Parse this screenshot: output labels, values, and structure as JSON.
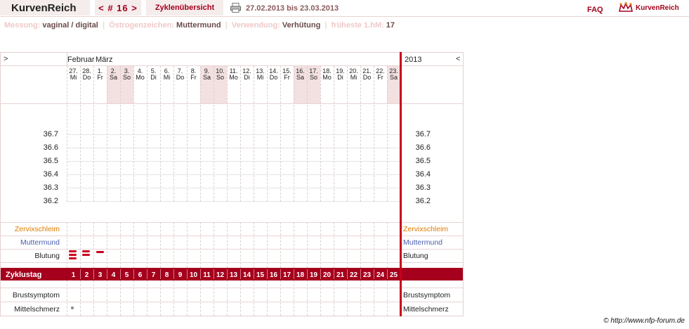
{
  "header": {
    "logo": "KurvenReich",
    "cycle_nav": "< # 16 >",
    "overview": "Zyklenübersicht",
    "date_range": "27.02.2013 bis 23.03.2013",
    "faq": "FAQ",
    "brand": "KurvenReich"
  },
  "info": {
    "messung_label": "Messung:",
    "messung_value": "vaginal / digital",
    "oestrogen_label": "Östrogenzeichen:",
    "oestrogen_value": "Muttermund",
    "verwendung_label": "Verwendung:",
    "verwendung_value": "Verhütung",
    "hm_label": "früheste 1.hM:",
    "hm_value": "17"
  },
  "chart": {
    "nav_prev": ">",
    "nav_next": "<",
    "month_left": "Februar",
    "month_right": "März",
    "year": "2013",
    "temps": [
      "36.7",
      "36.6",
      "36.5",
      "36.4",
      "36.3",
      "36.2"
    ],
    "days": [
      {
        "n": "27.",
        "w": "Mi"
      },
      {
        "n": "28.",
        "w": "Do"
      },
      {
        "n": "1.",
        "w": "Fr"
      },
      {
        "n": "2.",
        "w": "Sa"
      },
      {
        "n": "3.",
        "w": "So"
      },
      {
        "n": "4.",
        "w": "Mo"
      },
      {
        "n": "5.",
        "w": "Di"
      },
      {
        "n": "6.",
        "w": "Mi"
      },
      {
        "n": "7.",
        "w": "Do"
      },
      {
        "n": "8.",
        "w": "Fr"
      },
      {
        "n": "9.",
        "w": "Sa"
      },
      {
        "n": "10.",
        "w": "So"
      },
      {
        "n": "11.",
        "w": "Mo"
      },
      {
        "n": "12.",
        "w": "Di"
      },
      {
        "n": "13.",
        "w": "Mi"
      },
      {
        "n": "14.",
        "w": "Do"
      },
      {
        "n": "15.",
        "w": "Fr"
      },
      {
        "n": "16.",
        "w": "Sa"
      },
      {
        "n": "17.",
        "w": "So"
      },
      {
        "n": "18.",
        "w": "Mo"
      },
      {
        "n": "19.",
        "w": "Di"
      },
      {
        "n": "20.",
        "w": "Mi"
      },
      {
        "n": "21.",
        "w": "Do"
      },
      {
        "n": "22.",
        "w": "Fr"
      },
      {
        "n": "23.",
        "w": "Sa"
      }
    ],
    "weekend_color": "#f3e0e0",
    "zervix_label": "Zervixschleim",
    "zervix_color": "#e07b00",
    "muttermund_label": "Muttermund",
    "muttermund_color": "#4a5fb0",
    "blutung_label": "Blutung",
    "blutung_marks": [
      3,
      2,
      1
    ],
    "zyklustag_label": "Zyklustag",
    "zyklustag_days": [
      "1",
      "2",
      "3",
      "4",
      "5",
      "6",
      "7",
      "8",
      "9",
      "10",
      "11",
      "12",
      "13",
      "14",
      "15",
      "16",
      "17",
      "18",
      "19",
      "20",
      "21",
      "22",
      "23",
      "24",
      "25"
    ],
    "accent": "#a5001c",
    "brust_label": "Brustsymptom",
    "mittel_label": "Mittelschmerz",
    "mittel_marks": [
      1
    ]
  },
  "footer": {
    "copyright": "© http://www.nfp-forum.de"
  }
}
